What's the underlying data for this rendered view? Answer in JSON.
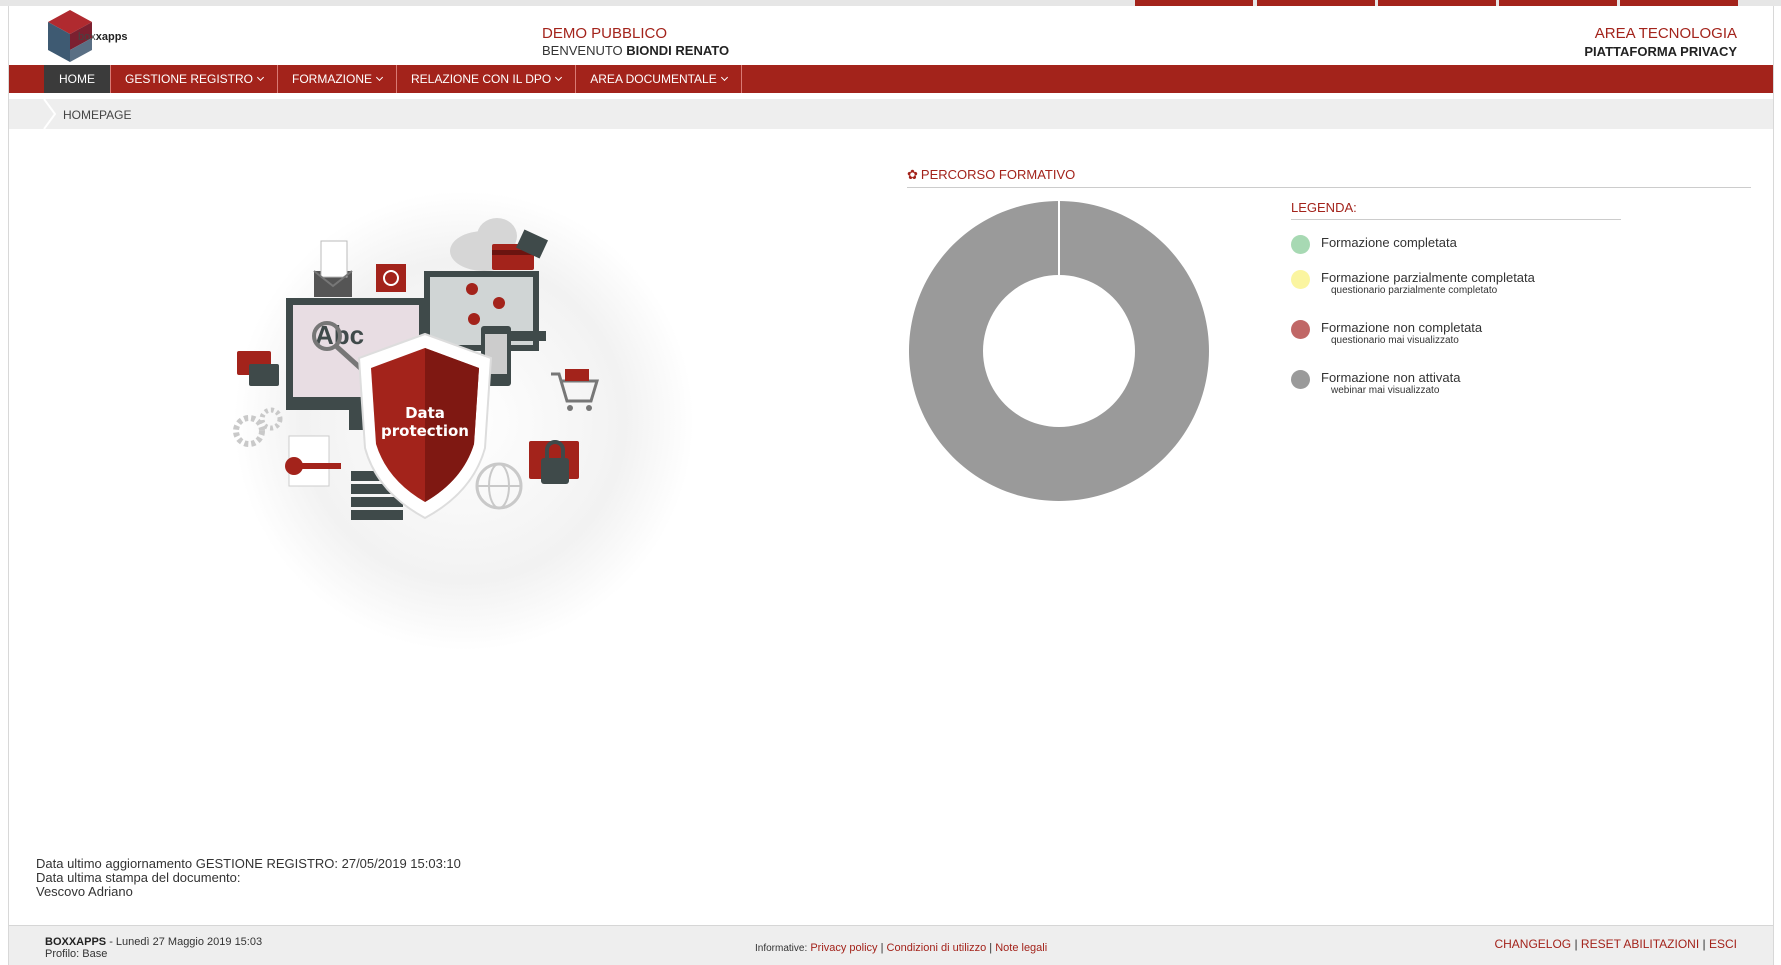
{
  "colors": {
    "accent": "#a3231b",
    "nav_active": "#3b3b3b",
    "legend_completata": "#a7d9b3",
    "legend_parziale": "#fbf5a0",
    "legend_non_completata": "#c06766",
    "legend_non_attivata": "#9a9a9a"
  },
  "header": {
    "logo_brand_a": "box",
    "logo_brand_b": "xapps",
    "demo_label": "DEMO PUBBLICO",
    "welcome_prefix": "BENVENUTO",
    "welcome_user": "BIONDI RENATO",
    "area_label": "AREA TECNOLOGIA",
    "platform_label": "PIATTAFORMA PRIVACY"
  },
  "nav": {
    "items": [
      {
        "label": "HOME"
      },
      {
        "label": "GESTIONE REGISTRO"
      },
      {
        "label": "FORMAZIONE"
      },
      {
        "label": "RELAZIONE CON IL DPO"
      },
      {
        "label": "AREA DOCUMENTALE"
      }
    ]
  },
  "breadcrumb": {
    "label": "HOMEPAGE"
  },
  "illustration": {
    "shield_line1": "Data",
    "shield_line2": "protection",
    "screen_text": "Abc"
  },
  "percorso": {
    "icon": "gear-icon",
    "title": "PERCORSO FORMATIVO",
    "legend_title": "LEGENDA:",
    "legend": [
      {
        "label": "Formazione completata",
        "sub": ""
      },
      {
        "label": "Formazione parzialmente completata",
        "sub": "questionario parzialmente completato"
      },
      {
        "label": "Formazione non completata",
        "sub": "questionario mai visualizzato"
      },
      {
        "label": "Formazione non attivata",
        "sub": "webinar mai visualizzato"
      }
    ]
  },
  "chart_data": {
    "type": "pie",
    "categories": [
      "Formazione completata",
      "Formazione parzialmente completata",
      "Formazione non completata",
      "Formazione non attivata"
    ],
    "values": [
      0,
      0,
      0,
      100
    ],
    "donut": true
  },
  "info": {
    "line1": "Data ultimo aggiornamento GESTIONE REGISTRO: 27/05/2019 15:03:10",
    "line2": "Data ultima stampa del documento:",
    "line3": "Vescovo Adriano"
  },
  "footer": {
    "brand": "BOXXAPPS",
    "datetime": " - Lunedì 27 Maggio 2019 15:03",
    "profile": "Profilo: Base",
    "informative_label": "Informative:",
    "privacy": "Privacy policy",
    "conditions": "Condizioni di utilizzo",
    "legal": "Note legali",
    "sep": " | ",
    "changelog": "CHANGELOG",
    "reset": "RESET ABILITAZIONI",
    "exit": "ESCI"
  }
}
